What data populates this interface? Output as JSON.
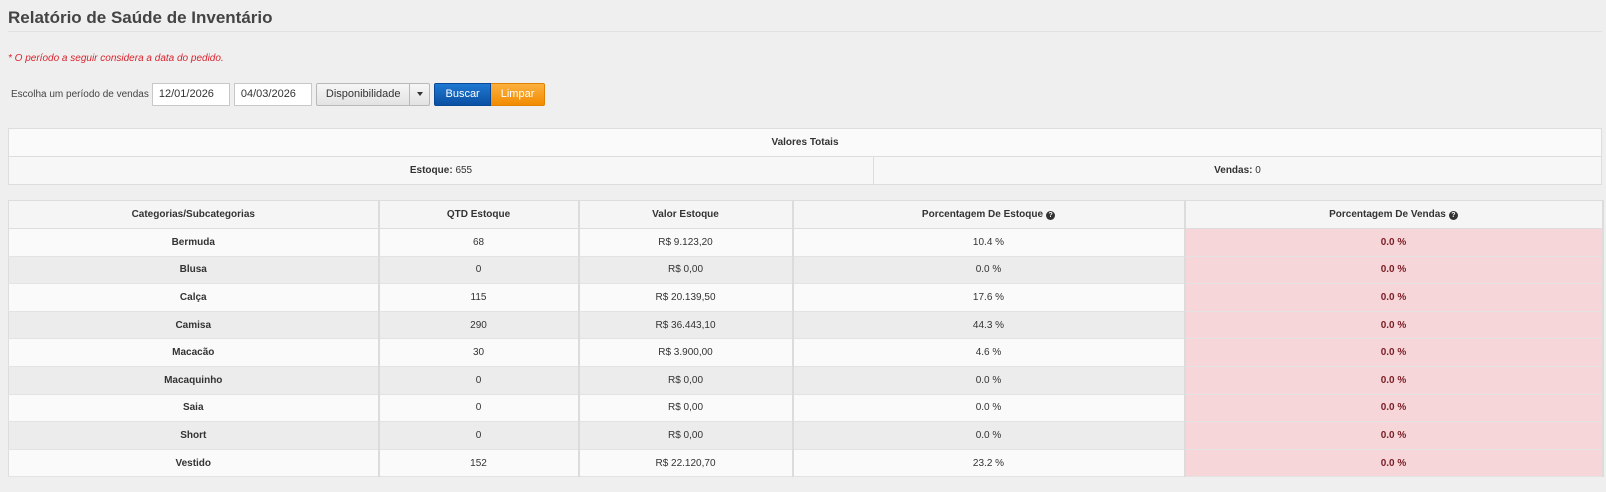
{
  "page": {
    "title": "Relatório de Saúde de Inventário",
    "note": "* O período a seguir considera a data do pedido."
  },
  "filters": {
    "label": "Escolha um período de vendas",
    "start_date": "12/01/2026",
    "end_date": "04/03/2026",
    "mode_select": "Disponibilidade",
    "search_label": "Buscar",
    "clear_label": "Limpar"
  },
  "totals": {
    "title": "Valores Totais",
    "stock_label": "Estoque:",
    "stock_value": "655",
    "sales_label": "Vendas:",
    "sales_value": "0"
  },
  "table": {
    "headers": [
      "Categorias/Subcategorias",
      "QTD Estoque",
      "Valor Estoque",
      "Porcentagem De Estoque",
      "Porcentagem De Vendas"
    ],
    "help_glyph": "?",
    "rows": [
      {
        "category": "Bermuda",
        "qty": "68",
        "value": "R$ 9.123,20",
        "stock_pct": "10.4 %",
        "sales_pct": "0.0 %"
      },
      {
        "category": "Blusa",
        "qty": "0",
        "value": "R$ 0,00",
        "stock_pct": "0.0 %",
        "sales_pct": "0.0 %"
      },
      {
        "category": "Calça",
        "qty": "115",
        "value": "R$ 20.139,50",
        "stock_pct": "17.6 %",
        "sales_pct": "0.0 %"
      },
      {
        "category": "Camisa",
        "qty": "290",
        "value": "R$ 36.443,10",
        "stock_pct": "44.3 %",
        "sales_pct": "0.0 %"
      },
      {
        "category": "Macacão",
        "qty": "30",
        "value": "R$ 3.900,00",
        "stock_pct": "4.6 %",
        "sales_pct": "0.0 %"
      },
      {
        "category": "Macaquinho",
        "qty": "0",
        "value": "R$ 0,00",
        "stock_pct": "0.0 %",
        "sales_pct": "0.0 %"
      },
      {
        "category": "Saia",
        "qty": "0",
        "value": "R$ 0,00",
        "stock_pct": "0.0 %",
        "sales_pct": "0.0 %"
      },
      {
        "category": "Short",
        "qty": "0",
        "value": "R$ 0,00",
        "stock_pct": "0.0 %",
        "sales_pct": "0.0 %"
      },
      {
        "category": "Vestido",
        "qty": "152",
        "value": "R$ 22.120,70",
        "stock_pct": "23.2 %",
        "sales_pct": "0.0 %"
      }
    ]
  },
  "colors": {
    "sales_highlight": "#f6d6d9",
    "search_button": "#0a4fa3",
    "clear_button": "#f28c00",
    "note_text": "#d9232d"
  }
}
